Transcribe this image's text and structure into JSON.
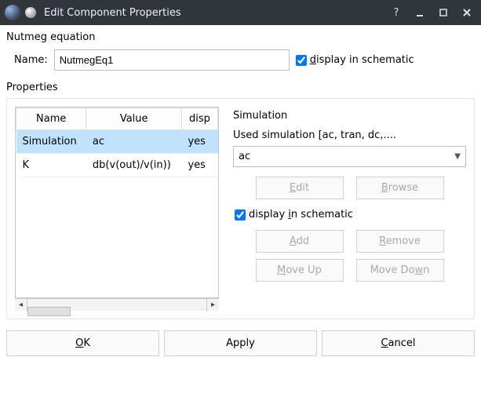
{
  "window": {
    "title": "Edit Component Properties"
  },
  "header_label": "Nutmeg equation",
  "name_row": {
    "label": "Name:",
    "value": "NutmegEq1",
    "display_label_pre": "",
    "display_label_underline": "d",
    "display_label_post": "isplay in schematic",
    "display_checked": true
  },
  "properties_label": "Properties",
  "table": {
    "headers": [
      "Name",
      "Value",
      "disp"
    ],
    "rows": [
      {
        "name": "Simulation",
        "value": "ac",
        "display": "yes",
        "selected": true
      },
      {
        "name": "K",
        "value": "db(v(out)/v(in))",
        "display": "yes",
        "selected": false
      }
    ]
  },
  "right_panel": {
    "title": "Simulation",
    "subtitle": "Used simulation [ac, tran, dc,....",
    "combo_value": "ac",
    "edit_pre": "",
    "edit_u": "E",
    "edit_post": "dit",
    "browse_pre": "",
    "browse_u": "B",
    "browse_post": "rowse",
    "disp_pre": "display ",
    "disp_u": "i",
    "disp_post": "n schematic",
    "disp_checked": true,
    "add_pre": "",
    "add_u": "A",
    "add_post": "dd",
    "remove_pre": "",
    "remove_u": "R",
    "remove_post": "emove",
    "moveup_pre": "",
    "moveup_u": "M",
    "moveup_post": "ove Up",
    "movedown_pre": "Move Do",
    "movedown_u": "w",
    "movedown_post": "n"
  },
  "bottom": {
    "ok_pre": "",
    "ok_u": "O",
    "ok_post": "K",
    "apply": "Apply",
    "cancel_pre": "",
    "cancel_u": "C",
    "cancel_post": "ancel"
  }
}
